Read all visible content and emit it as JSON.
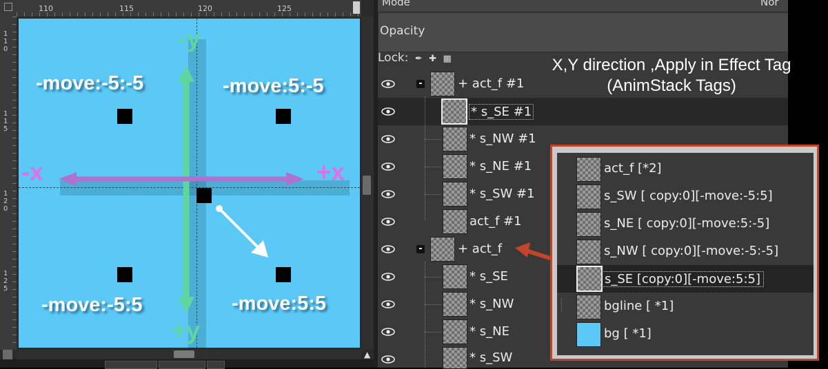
{
  "ruler": {
    "h_labels": [
      "110",
      "115",
      "120",
      "125"
    ],
    "v_labels": [
      "110",
      "115",
      "120",
      "125"
    ]
  },
  "canvas": {
    "bg_color": "#5bc8f5",
    "labels": {
      "nw": "-move:-5:-5",
      "ne": "-move:5:-5",
      "sw": "-move:-5:5",
      "se": "-move:5:5"
    },
    "axes": {
      "minus_y": "-y",
      "plus_y": "+y",
      "minus_x": "-x",
      "plus_x": "+x"
    },
    "colors": {
      "y_axis": "#5fd6a0",
      "x_axis": "#b070d0",
      "axis_text_y": "#5fd6a0",
      "axis_text_x": "#e070e8"
    }
  },
  "panel": {
    "mode_label": "Mode",
    "mode_value": "Nor",
    "opacity_label": "Opacity",
    "lock_label": "Lock:"
  },
  "annotation": {
    "line1": "X,Y direction ,Apply in Effect Tag",
    "line2": "(AnimStack Tags)"
  },
  "layers": [
    {
      "name": "+ act_f #1",
      "group": true
    },
    {
      "name": "* s_SE #1",
      "selected": true
    },
    {
      "name": "* s_NW #1"
    },
    {
      "name": "* s_NE #1"
    },
    {
      "name": "* s_SW #1"
    },
    {
      "name": "act_f #1"
    },
    {
      "name": "+ act_f",
      "group": true
    },
    {
      "name": "* s_SE"
    },
    {
      "name": "* s_NW"
    },
    {
      "name": "* s_NE"
    },
    {
      "name": "* s_SW"
    }
  ],
  "inset_layers": [
    {
      "name": "act_f  [*2]"
    },
    {
      "name": "s_SW    [ copy:0][-move:-5:5]"
    },
    {
      "name": "s_NE    [ copy:0][-move:5:-5]"
    },
    {
      "name": "s_NW   [ copy:0][-move:-5:-5]"
    },
    {
      "name": "s_SE    [copy:0][-move:5:5]",
      "selected": true
    },
    {
      "name": "bgline  [ *1]"
    },
    {
      "name": "bg  [ *1]",
      "color": "#5bc8f5"
    }
  ],
  "accent": {
    "callout_border": "#c2442a",
    "callout_arrow": "#c2442a"
  }
}
